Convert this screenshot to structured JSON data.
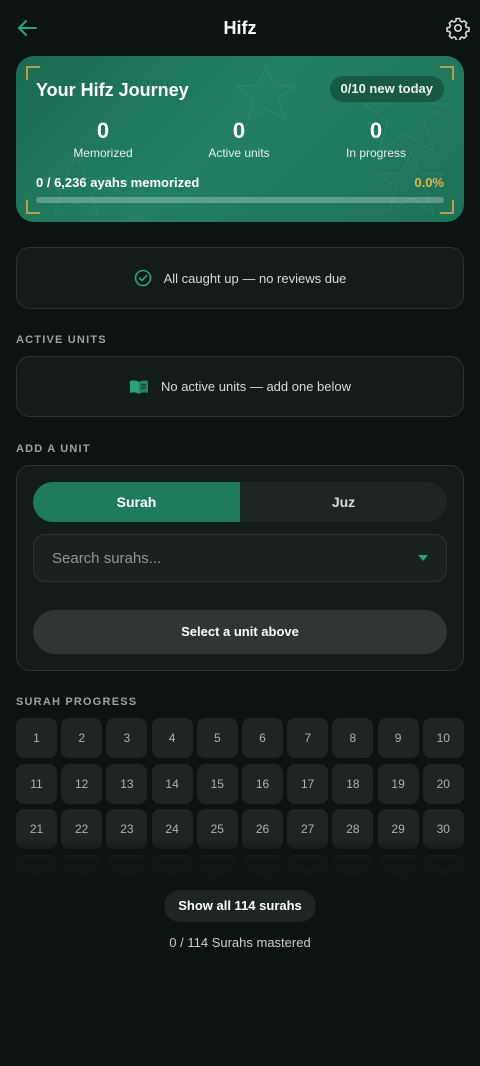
{
  "header": {
    "title": "Hifz",
    "back_icon": "arrow-left-icon",
    "settings_icon": "gear-icon"
  },
  "journey": {
    "title": "Your Hifz Journey",
    "new_today": "0/10 new today",
    "stats": [
      {
        "value": "0",
        "label": "Memorized"
      },
      {
        "value": "0",
        "label": "Active units"
      },
      {
        "value": "0",
        "label": "In progress"
      }
    ],
    "ayahs_text": "0 / 6,236 ayahs memorized",
    "percent_text": "0.0%",
    "progress_fraction": 0.0,
    "accent_color": "#e0b44a"
  },
  "reviews": {
    "message": "All caught up — no reviews due",
    "icon": "check-circle-icon"
  },
  "active_units": {
    "label": "ACTIVE UNITS",
    "message": "No active units — add one below",
    "icon": "book-open-icon"
  },
  "add_unit": {
    "label": "ADD A UNIT",
    "tabs": [
      "Surah",
      "Juz"
    ],
    "selected_tab": "Surah",
    "search_placeholder": "Search surahs...",
    "search_value": "",
    "select_button": "Select a unit above"
  },
  "surah_progress": {
    "label": "SURAH PROGRESS",
    "cells": [
      "1",
      "2",
      "3",
      "4",
      "5",
      "6",
      "7",
      "8",
      "9",
      "10",
      "11",
      "12",
      "13",
      "14",
      "15",
      "16",
      "17",
      "18",
      "19",
      "20",
      "21",
      "22",
      "23",
      "24",
      "25",
      "26",
      "27",
      "28",
      "29",
      "30",
      "31",
      "32",
      "33",
      "34",
      "35",
      "36",
      "37",
      "38",
      "39",
      "40"
    ],
    "show_all": "Show all 114 surahs",
    "mastered_text": "0 / 114 Surahs mastered"
  },
  "colors": {
    "background": "#0b1412",
    "brand_green": "#1f7a5e",
    "accent_green": "#2ba47a"
  }
}
